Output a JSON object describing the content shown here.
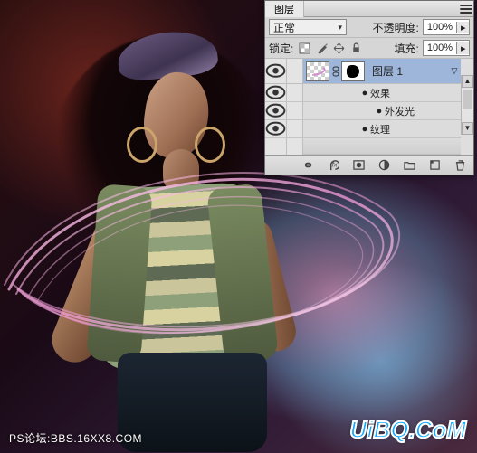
{
  "watermarks": {
    "left": "PS论坛:BBS.16XX8.COM",
    "right": "UiBQ.CoM"
  },
  "panel": {
    "tab_label": "图层",
    "blend_row": {
      "mode": "正常",
      "opacity_label": "不透明度:",
      "opacity_value": "100%"
    },
    "lock_row": {
      "lock_label": "锁定:",
      "fill_label": "填充:",
      "fill_value": "100%"
    },
    "layers": [
      {
        "name": "图层 1",
        "selected": true,
        "effects_label": "效果",
        "outer_glow_label": "外发光"
      }
    ],
    "texture_label": "纹理"
  }
}
